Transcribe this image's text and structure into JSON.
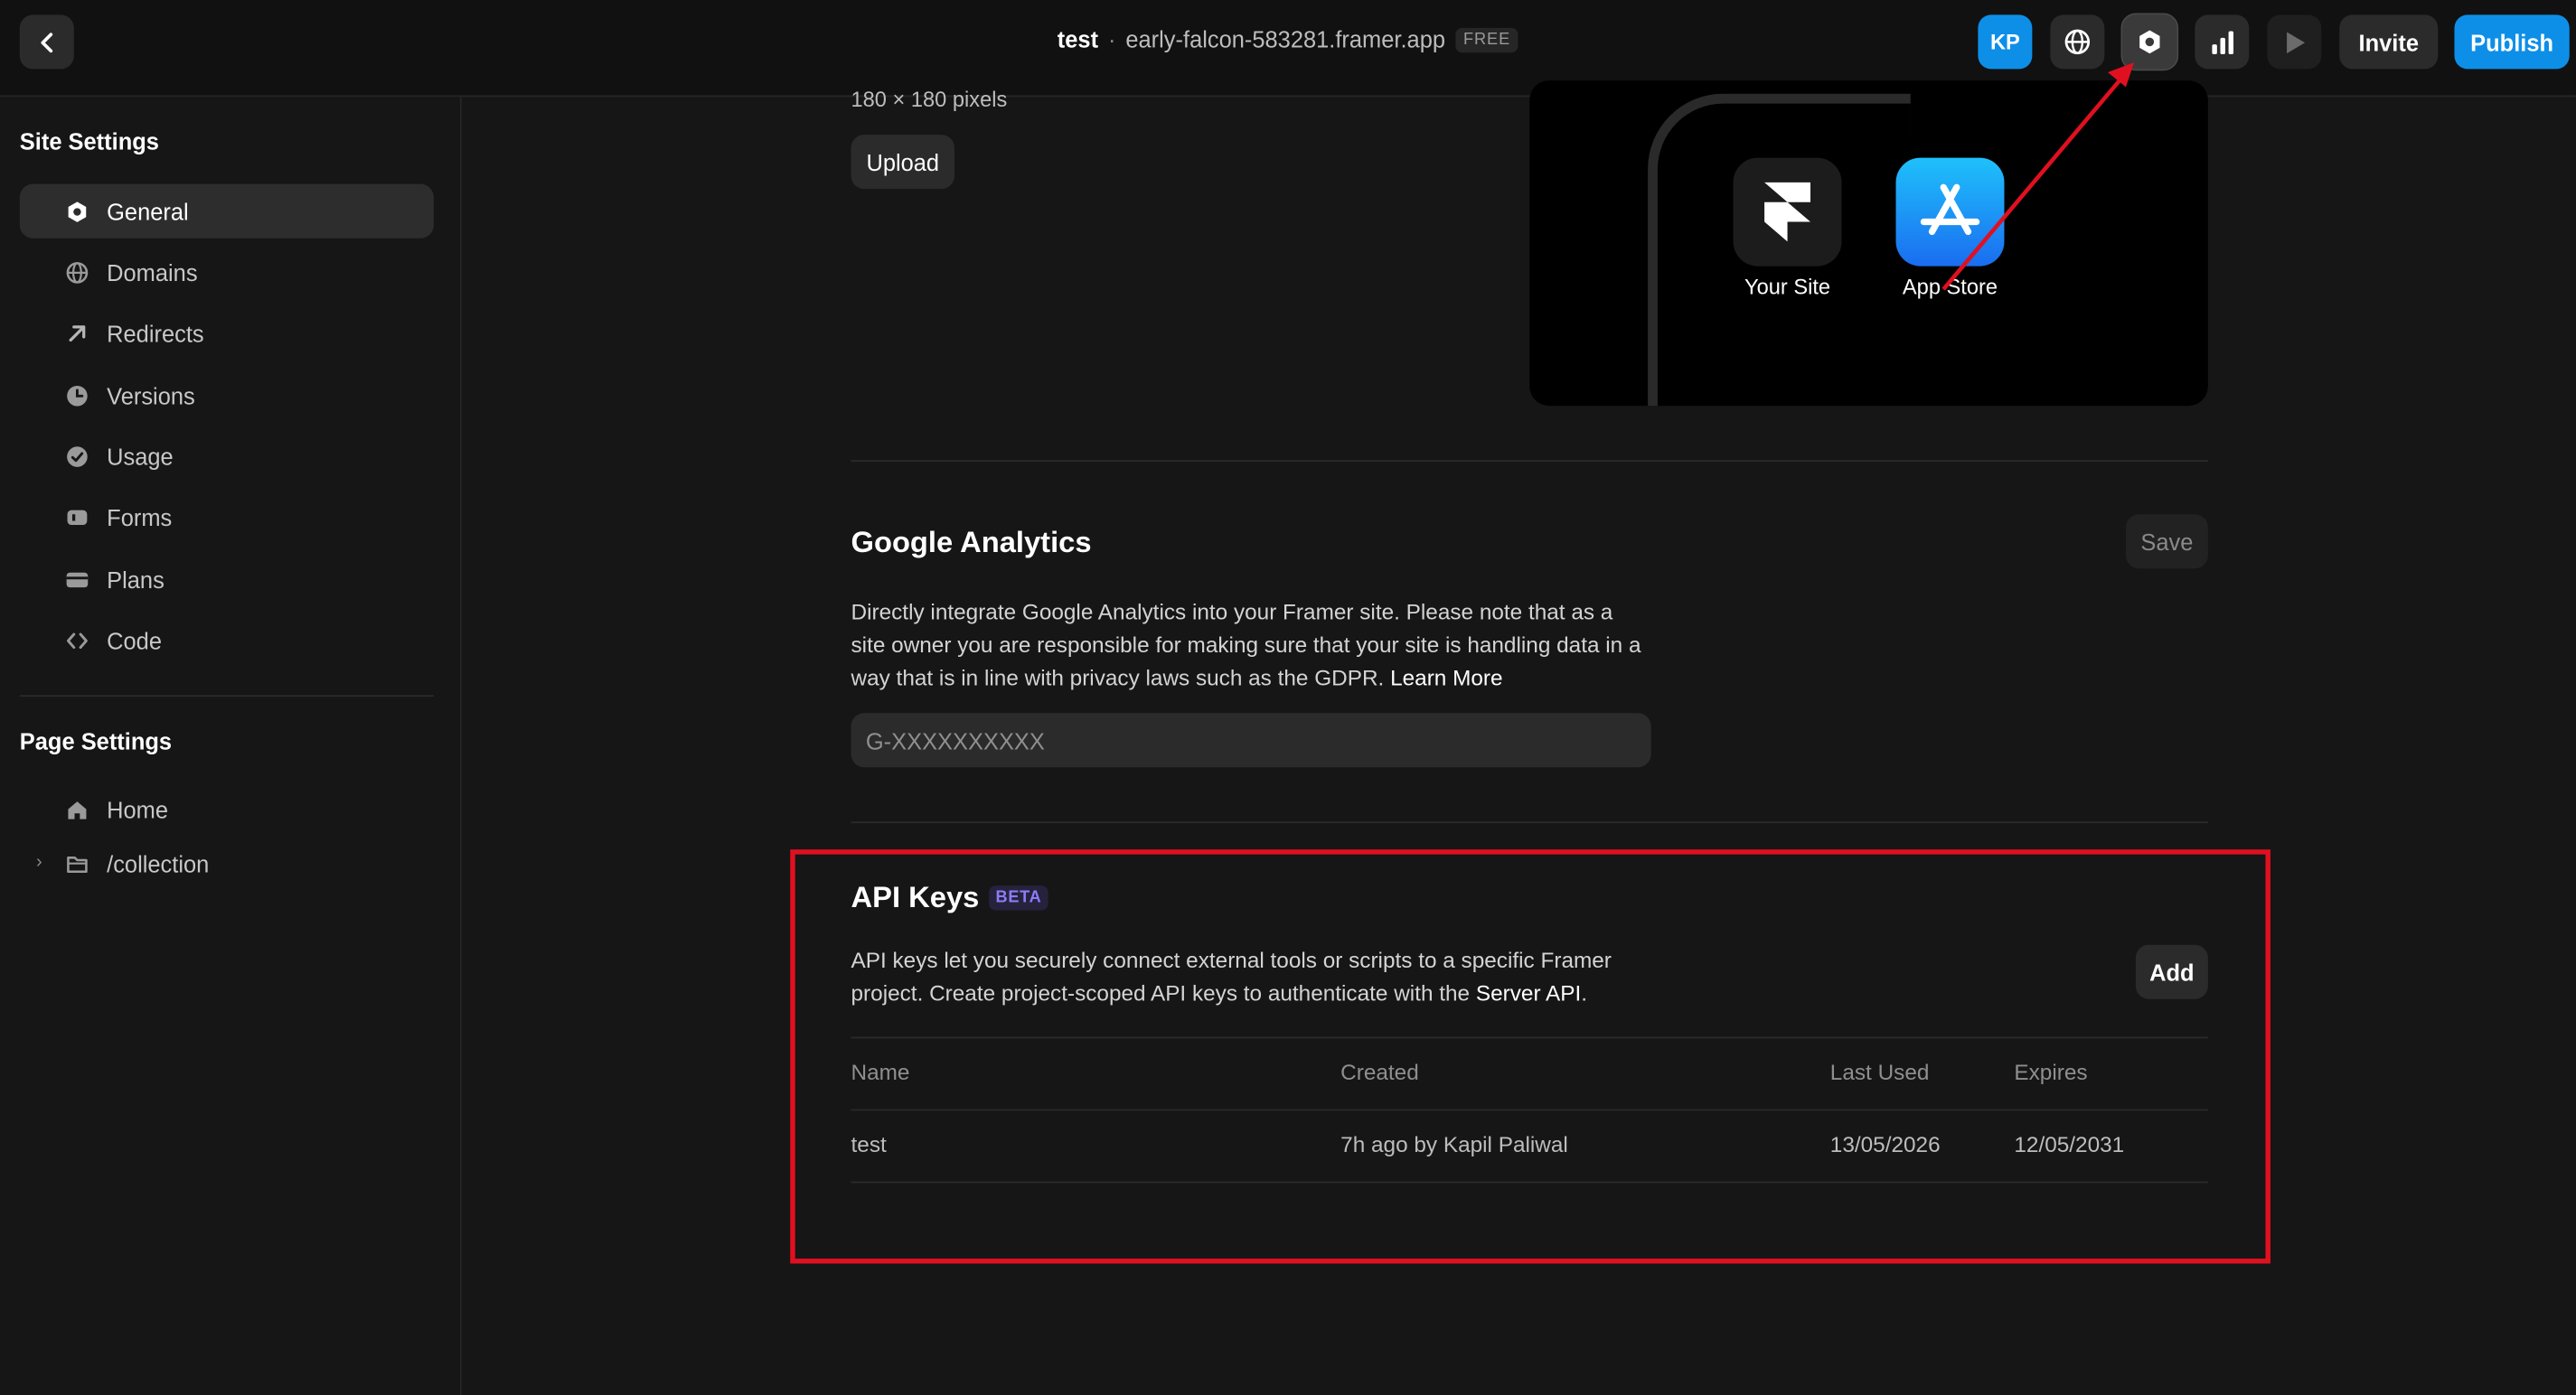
{
  "topbar": {
    "project_name": "test",
    "separator": "·",
    "domain": "early-falcon-583281.framer.app",
    "plan_badge": "FREE",
    "avatar_initials": "KP",
    "invite_label": "Invite",
    "publish_label": "Publish"
  },
  "sidebar": {
    "site_settings_title": "Site Settings",
    "site_items": [
      {
        "label": "General",
        "icon": "gear-icon",
        "active": true
      },
      {
        "label": "Domains",
        "icon": "globe-icon"
      },
      {
        "label": "Redirects",
        "icon": "arrow-up-right-icon"
      },
      {
        "label": "Versions",
        "icon": "clock-icon"
      },
      {
        "label": "Usage",
        "icon": "gauge-icon"
      },
      {
        "label": "Forms",
        "icon": "form-icon"
      },
      {
        "label": "Plans",
        "icon": "card-icon"
      },
      {
        "label": "Code",
        "icon": "code-icon"
      }
    ],
    "page_settings_title": "Page Settings",
    "page_items": [
      {
        "label": "Home",
        "icon": "home-icon"
      },
      {
        "label": "/collection",
        "icon": "folder-icon",
        "expandable": true
      }
    ]
  },
  "icon_section": {
    "size_caption": "180 × 180 pixels",
    "upload_label": "Upload",
    "preview": {
      "your_site_label": "Your Site",
      "app_store_label": "App Store"
    }
  },
  "google_analytics": {
    "title": "Google Analytics",
    "save_label": "Save",
    "description": "Directly integrate Google Analytics into your Framer site. Please note that as a site owner you are responsible for making sure that your site is handling data in a way that is in line with privacy laws such as the GDPR.",
    "learn_more": "Learn More",
    "input_placeholder": "G-XXXXXXXXXX",
    "input_value": ""
  },
  "api_keys": {
    "title": "API Keys",
    "badge": "BETA",
    "description": "API keys let you securely connect external tools or scripts to a specific Framer project. Create project-scoped API keys to authenticate with the",
    "server_api_link": "Server API",
    "description_end": ".",
    "add_label": "Add",
    "columns": [
      "Name",
      "Created",
      "Last Used",
      "Expires"
    ],
    "rows": [
      {
        "name": "test",
        "created": "7h ago by Kapil Paliwal",
        "last_used": "13/05/2026",
        "expires": "12/05/2031"
      }
    ]
  },
  "colors": {
    "accent_blue": "#0d8fe8",
    "annotation_red": "#e01020",
    "beta_purple": "#8b7cf6"
  }
}
